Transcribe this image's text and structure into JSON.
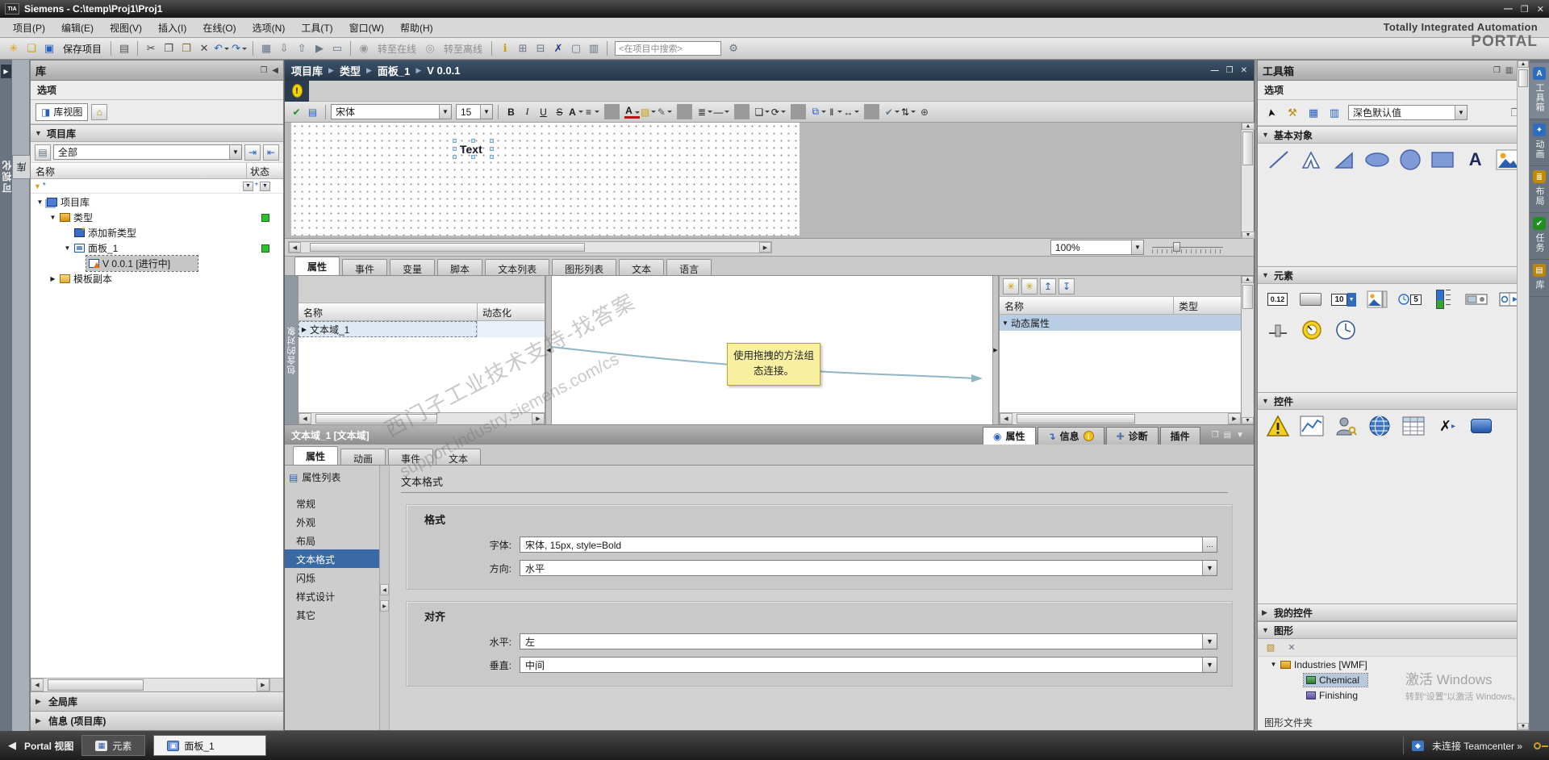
{
  "window": {
    "title": "Siemens - C:\\temp\\Proj1\\Proj1"
  },
  "tia": {
    "line1": "Totally Integrated Automation",
    "line2": "PORTAL"
  },
  "menu": {
    "items": [
      {
        "label": "项目(P)"
      },
      {
        "label": "编辑(E)"
      },
      {
        "label": "视图(V)"
      },
      {
        "label": "插入(I)"
      },
      {
        "label": "在线(O)"
      },
      {
        "label": "选项(N)"
      },
      {
        "label": "工具(T)"
      },
      {
        "label": "窗口(W)"
      },
      {
        "label": "帮助(H)"
      }
    ]
  },
  "toolbar": {
    "items": [
      {
        "name": "new-project-icon",
        "g": "✳",
        "c": "#e0a000"
      },
      {
        "name": "open-project-icon",
        "g": "❏",
        "c": "#d79b00"
      },
      {
        "name": "save-project-icon",
        "g": "▣",
        "c": "#2660c0"
      },
      {
        "name": "save-project-label",
        "g": "保存项目",
        "cls": "tlabel",
        "inter": "false"
      },
      {
        "cls": "sep",
        "inter": "false",
        "g": ""
      },
      {
        "name": "print-icon",
        "g": "▤",
        "c": "#555555"
      },
      {
        "cls": "sep",
        "inter": "false",
        "g": ""
      },
      {
        "name": "cut-icon",
        "g": "✂",
        "c": "#444444"
      },
      {
        "name": "copy-icon",
        "g": "❐",
        "c": "#444444"
      },
      {
        "name": "paste-icon",
        "g": "❒",
        "c": "#8a6a30"
      },
      {
        "name": "delete-icon",
        "g": "✕",
        "c": "#444444"
      },
      {
        "name": "undo-icon",
        "g": "↶",
        "c": "#2660c0",
        "cls": "drop"
      },
      {
        "name": "redo-icon",
        "g": "↷",
        "c": "#2660c0",
        "cls": "drop"
      },
      {
        "cls": "sep",
        "inter": "false",
        "g": ""
      },
      {
        "name": "compile-icon",
        "g": "▦",
        "c": "#667688"
      },
      {
        "name": "download-to-device-icon",
        "g": "⇩",
        "c": "#667688"
      },
      {
        "name": "upload-from-device-icon",
        "g": "⇧",
        "c": "#667688"
      },
      {
        "name": "start-simulation-icon",
        "g": "▶",
        "c": "#667688"
      },
      {
        "name": "runtime-icon",
        "g": "▭",
        "c": "#667688"
      },
      {
        "cls": "sep",
        "inter": "false",
        "g": ""
      },
      {
        "name": "go-online-icon",
        "g": "◉",
        "c": "#9a9a9a"
      },
      {
        "name": "go-online-label",
        "g": "转至在线",
        "cls": "tlabel dis"
      },
      {
        "name": "go-offline-icon",
        "g": "◎",
        "c": "#9a9a9a"
      },
      {
        "name": "go-offline-label",
        "g": "转至离线",
        "cls": "tlabel dis"
      },
      {
        "cls": "sep",
        "inter": "false",
        "g": ""
      },
      {
        "name": "diagnostics-icon",
        "g": "ℹ",
        "c": "#c8a000"
      },
      {
        "name": "split-horizontal-icon",
        "g": "⊞",
        "c": "#667688"
      },
      {
        "name": "split-vertical-icon",
        "g": "⊟",
        "c": "#667688"
      },
      {
        "name": "cross-reference-icon",
        "g": "✗",
        "c": "#1a3a8c"
      },
      {
        "name": "window-icon",
        "g": "▢",
        "c": "#667688"
      },
      {
        "name": "layout-icon",
        "g": "▥",
        "c": "#667688"
      },
      {
        "cls": "sep",
        "inter": "false",
        "g": ""
      },
      {
        "name": "project-search-input",
        "g": "<在项目中搜索>",
        "cls": "search"
      },
      {
        "name": "search-settings-icon",
        "g": "⚙",
        "c": "#667688"
      }
    ]
  },
  "left_edge": {
    "category": "可视化",
    "tab": "库"
  },
  "library": {
    "title": "库",
    "options": "选项",
    "view_button": "库视图",
    "section": "项目库",
    "filter": "全部",
    "col_name": "名称",
    "col_status": "状态",
    "tree": [
      {
        "label": "项目库",
        "cls": "lv0",
        "arrow": "▼",
        "iconCls": "ic-lib",
        "statusCls": "hide"
      },
      {
        "label": "类型",
        "cls": "lv1",
        "arrow": "▼",
        "iconCls": "ic-folder",
        "statusCls": "green"
      },
      {
        "label": "添加新类型",
        "cls": "lv2",
        "arrow": "",
        "iconCls": "ic-new",
        "statusCls": "hide"
      },
      {
        "label": "面板_1",
        "cls": "lv2",
        "arrow": "▼",
        "iconCls": "ic-panel",
        "statusCls": "green"
      },
      {
        "label": "V 0.0.1 [进行中]",
        "cls": "lv3 selected",
        "arrow": "",
        "iconCls": "ic-version",
        "statusCls": "hide"
      },
      {
        "label": "模板副本",
        "cls": "lv1",
        "arrow": "▶",
        "iconCls": "ic-folder2",
        "statusCls": "hide"
      }
    ],
    "global": "全局库",
    "info": "信息 (项目库)"
  },
  "editor": {
    "breadcrumb": [
      {
        "label": "项目库"
      },
      {
        "label": "类型"
      },
      {
        "label": "面板_1"
      },
      {
        "label": "V 0.0.1"
      }
    ],
    "fmt": {
      "font": "宋体",
      "size": "15",
      "items": [
        {
          "name": "bold-icon",
          "g": "B",
          "cls": "bold"
        },
        {
          "name": "italic-icon",
          "g": "I",
          "cls": "italic"
        },
        {
          "name": "underline-icon",
          "g": "U",
          "cls": "und"
        },
        {
          "name": "strikethrough-icon",
          "g": "S",
          "cls": "strike"
        },
        {
          "name": "font-size-icon",
          "g": "A",
          "cls": "bold drop"
        },
        {
          "name": "paragraph-align-icon",
          "g": "≡",
          "cls": "drop"
        },
        {
          "cls": "sep",
          "inter": "false",
          "g": ""
        },
        {
          "name": "font-color-icon",
          "g": "A",
          "cls": "bold fcolor drop"
        },
        {
          "name": "background-color-icon",
          "g": "▨",
          "c": "#c8a000",
          "cls": "drop"
        },
        {
          "name": "pen-color-icon",
          "g": "✎",
          "c": "#555555",
          "cls": "drop"
        },
        {
          "cls": "sep",
          "inter": "false",
          "g": ""
        },
        {
          "name": "line-style-icon",
          "g": "≣",
          "cls": "drop"
        },
        {
          "name": "line-width-icon",
          "g": "—",
          "cls": "drop"
        },
        {
          "cls": "sep",
          "inter": "false",
          "g": ""
        },
        {
          "name": "arrange-icon",
          "g": "❏",
          "cls": "drop"
        },
        {
          "name": "rotate-icon",
          "g": "⟳",
          "cls": "drop"
        },
        {
          "cls": "sep",
          "inter": "false",
          "g": ""
        },
        {
          "name": "group-icon",
          "g": "⧉",
          "c": "#2660c0",
          "cls": "drop"
        },
        {
          "name": "align-objects-icon",
          "g": "‖",
          "cls": "drop"
        },
        {
          "name": "distribute-icon",
          "g": "↔",
          "cls": "drop"
        },
        {
          "cls": "sep",
          "inter": "false",
          "g": ""
        },
        {
          "name": "style-apply-icon",
          "g": "✔",
          "c": "#667688",
          "cls": "drop"
        },
        {
          "name": "tab-order-icon",
          "g": "⇅",
          "cls": "drop"
        },
        {
          "name": "zoom-selection-icon",
          "g": "⊕",
          "c": "#444444"
        }
      ]
    },
    "canvas": {
      "text": "Text"
    },
    "zoom": {
      "value": "100%"
    },
    "tabs": [
      {
        "label": "属性",
        "cls": "active"
      },
      {
        "label": "事件"
      },
      {
        "label": "变量"
      },
      {
        "label": "脚本"
      },
      {
        "label": "文本列表"
      },
      {
        "label": "图形列表"
      },
      {
        "label": "文本"
      },
      {
        "label": "语言"
      }
    ],
    "middle": {
      "vtab": "包含的对象",
      "left": {
        "col1": "名称",
        "col2": "动态化",
        "row": "文本域_1"
      },
      "note": "使用拖拽的方法组态连接。",
      "watermark1": "西门子工业技术支持-找答案",
      "watermark2": "support.industry.siemens.com/cs",
      "tools": [
        {
          "name": "add-dynamic-property-icon",
          "g": "✳",
          "c": "#c8a000"
        },
        {
          "name": "add-array-element-icon",
          "g": "✳",
          "c": "#c8a000"
        },
        {
          "name": "move-up-icon",
          "g": "↥",
          "c": "#2660c0"
        },
        {
          "name": "move-down-icon",
          "g": "↧",
          "c": "#2660c0"
        }
      ],
      "right": {
        "col1": "名称",
        "col2": "类型",
        "row": "动态属性"
      }
    }
  },
  "props": {
    "title": "文本域_1 [文本域]",
    "htabs": {
      "properties": "属性",
      "info": "信息",
      "diagnostics": "诊断",
      "plugins": "插件"
    },
    "tabs": [
      {
        "label": "属性",
        "cls": "active"
      },
      {
        "label": "动画"
      },
      {
        "label": "事件"
      },
      {
        "label": "文本"
      }
    ],
    "nav_header": "属性列表",
    "nav": [
      {
        "label": "常规"
      },
      {
        "label": "外观"
      },
      {
        "label": "布局"
      },
      {
        "label": "文本格式",
        "cls": "selected"
      },
      {
        "label": "闪烁"
      },
      {
        "label": "样式设计"
      },
      {
        "label": "其它"
      }
    ],
    "section_title": "文本格式",
    "group1": {
      "title": "格式",
      "font_label": "字体:",
      "font_value": "宋体, 15px, style=Bold",
      "dir_label": "方向:",
      "dir_value": "水平"
    },
    "group2": {
      "title": "对齐",
      "h_label": "水平:",
      "h_value": "左",
      "v_label": "垂直:",
      "v_value": "中间"
    }
  },
  "toolbox": {
    "title": "工具箱",
    "options": "选项",
    "style_value": "深色默认值",
    "sec_basic": "基本对象",
    "sec_elements": "元素",
    "sec_controls": "控件",
    "sec_my": "我的控件",
    "sec_graphics": "图形",
    "basic_a": "A",
    "io_value": "0.12",
    "sym_value": "10",
    "dt_value": "5",
    "gfx_tree": [
      {
        "label": "Industries [WMF]",
        "cls": "glv0",
        "arrow": "▼",
        "iconCls": "gi-wmf"
      },
      {
        "label": "Chemical",
        "cls": "glv1 gsel",
        "arrow": "",
        "iconCls": "gi-chem"
      },
      {
        "label": "Finishing",
        "cls": "glv1",
        "arrow": "",
        "iconCls": "gi-fin"
      }
    ],
    "gfx_footer": "图形文件夹",
    "win_line1": "激活 Windows",
    "win_line2": "转到“设置”以激活 Windows。"
  },
  "rstrip": {
    "tabs": [
      {
        "label": "工具箱",
        "icon": "A",
        "ic": "#2e6cc0",
        "cls": "active"
      },
      {
        "label": "动画",
        "icon": "✦",
        "ic": "#2e6cc0"
      },
      {
        "label": "布局",
        "icon": "≣",
        "ic": "#c08a00"
      },
      {
        "label": "任务",
        "icon": "✔",
        "ic": "#1f8f1f"
      },
      {
        "label": "库",
        "icon": "▤",
        "ic": "#b8860b"
      }
    ]
  },
  "statusbar": {
    "portal": "Portal 视图",
    "tab_elements": "元素",
    "tab_panel": "面板_1",
    "teamcenter": "未连接 Teamcenter »"
  }
}
